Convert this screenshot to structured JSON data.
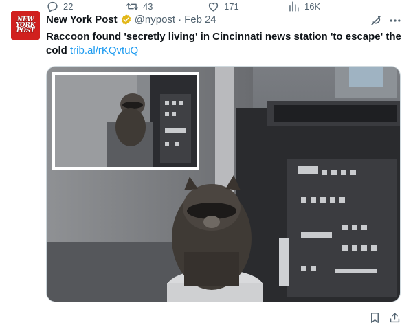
{
  "tweet": {
    "avatar_text": [
      "NEW",
      "YORK",
      "POST"
    ],
    "author_name": "New York Post",
    "handle": "@nypost",
    "separator": "·",
    "date": "Feb 24",
    "body": "Raccoon found 'secretly living' in Cincinnati news station 'to escape' the cold",
    "link": "trib.al/rKQvtuQ",
    "brand_color": "#d1201e",
    "verified_color": "#e2b719",
    "link_color": "#1d9bf0"
  },
  "actions": {
    "replies": "22",
    "retweets": "43",
    "likes": "171",
    "views": "16K"
  },
  "icons": [
    "grok-icon",
    "more-icon",
    "reply-icon",
    "retweet-icon",
    "like-icon",
    "views-icon",
    "bookmark-icon",
    "share-icon"
  ]
}
